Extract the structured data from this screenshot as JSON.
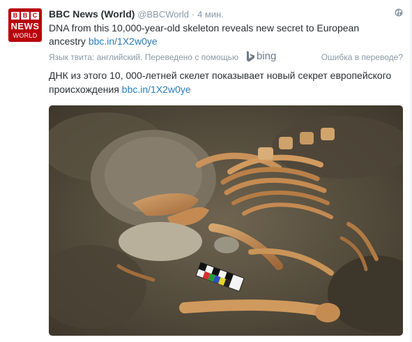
{
  "account": {
    "avatar": {
      "blocks": [
        "B",
        "B",
        "C"
      ],
      "line1": "NEWS",
      "line2": "WORLD"
    },
    "name": "BBC News (World)",
    "handle": "@BBCWorld",
    "separator": "·",
    "time": "4 мин."
  },
  "tweet": {
    "text": "DNA from this 10,000-year-old skeleton reveals new secret to European ancestry ",
    "link": "bbc.in/1X2w0ye"
  },
  "translation_bar": {
    "label": "Язык твита: английский. Переведено с помощью",
    "provider": "bing",
    "error_link": "Ошибка в переводе?"
  },
  "translated": {
    "text": "ДНК из этого 10, 000-летней скелет показывает новый секрет европейского происхождения ",
    "link": "bbc.in/1X2w0ye"
  },
  "icons": {
    "globe": "globe-icon",
    "bing": "bing-logo-icon"
  },
  "colors": {
    "brand_red": "#b8000a",
    "link": "#2b7bb9",
    "muted": "#8899a6"
  }
}
